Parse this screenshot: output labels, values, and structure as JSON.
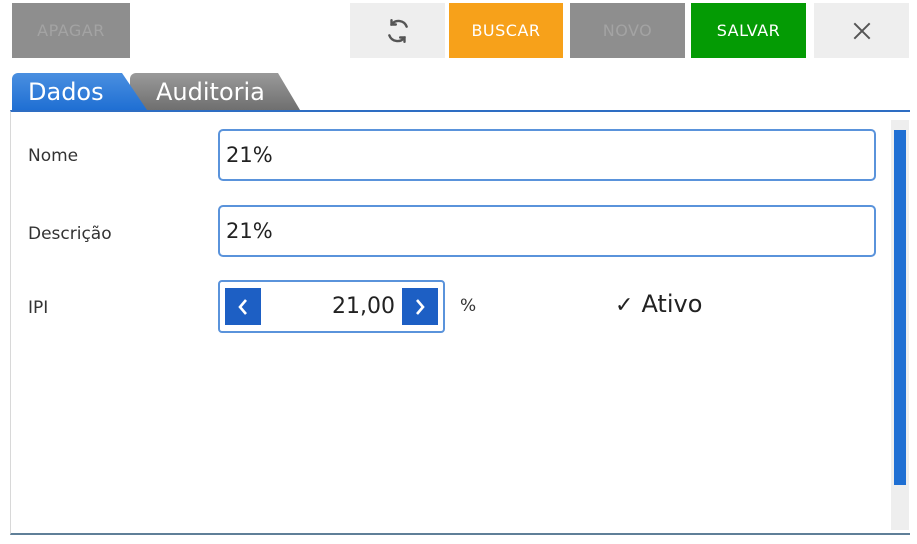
{
  "toolbar": {
    "apagar": "APAGAR",
    "buscar": "BUSCAR",
    "novo": "NOVO",
    "salvar": "SALVAR",
    "refresh_icon": "refresh-icon",
    "close_icon": "close-icon"
  },
  "tabs": [
    {
      "label": "Dados",
      "active": true
    },
    {
      "label": "Auditoria",
      "active": false
    }
  ],
  "form": {
    "nome": {
      "label": "Nome",
      "value": "21%"
    },
    "descricao": {
      "label": "Descrição",
      "value": "21%"
    },
    "ipi": {
      "label": "IPI",
      "value": "21,00",
      "unit": "%"
    },
    "ativo": {
      "label": "Ativo",
      "checked": true
    }
  },
  "colors": {
    "accent": "#1f6fd3",
    "buscar": "#f7a11a",
    "salvar": "#049b04",
    "disabled": "#8e8e8e"
  }
}
